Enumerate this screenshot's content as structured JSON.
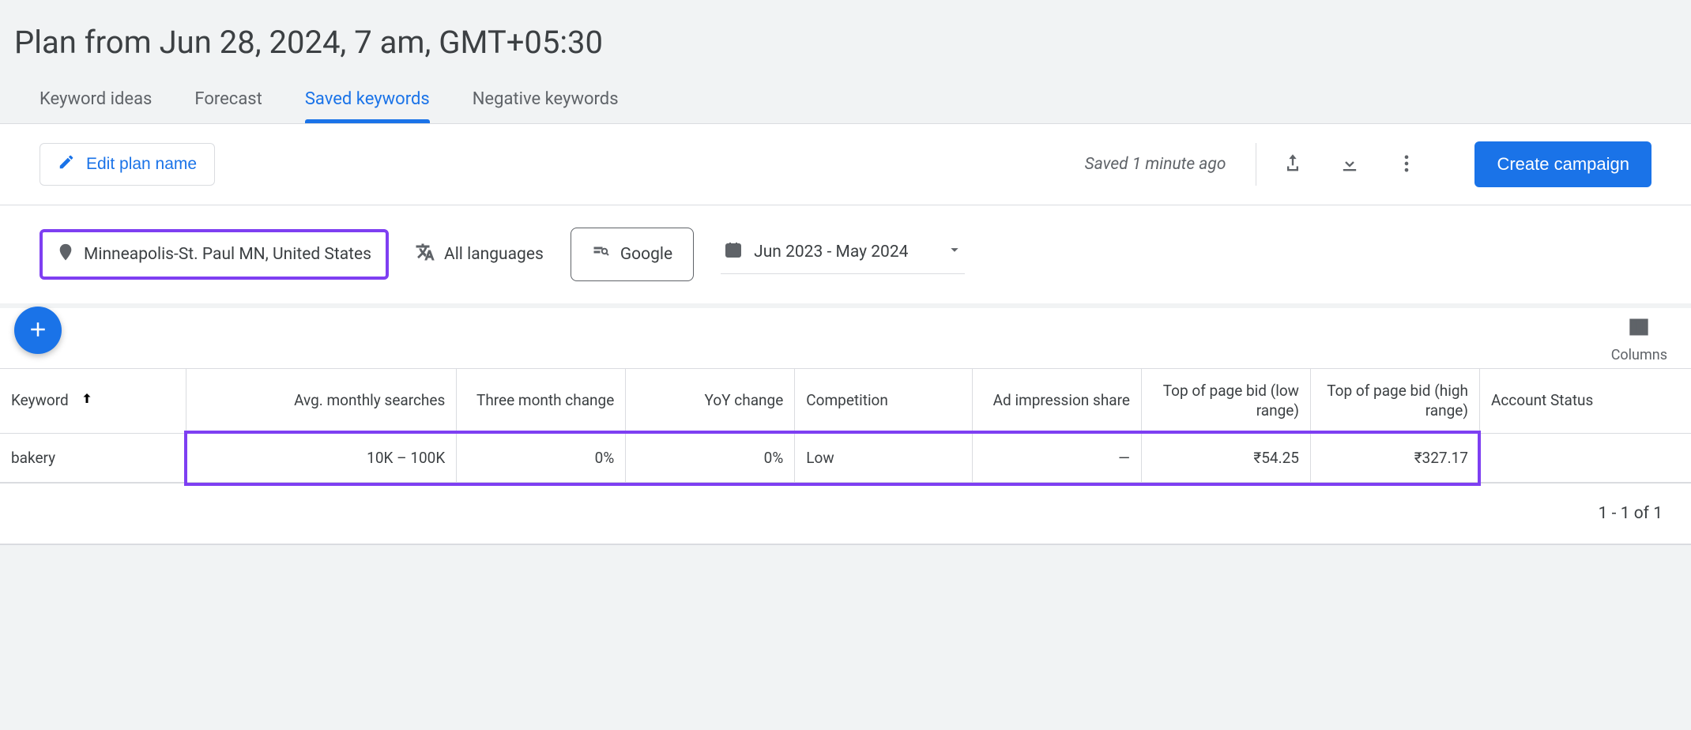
{
  "page_title": "Plan from Jun 28, 2024, 7 am, GMT+05:30",
  "tabs": {
    "keyword_ideas": "Keyword ideas",
    "forecast": "Forecast",
    "saved_keywords": "Saved keywords",
    "negative_keywords": "Negative keywords"
  },
  "toolbar": {
    "edit_plan_label": "Edit plan name",
    "saved_status": "Saved 1 minute ago",
    "create_campaign_label": "Create campaign"
  },
  "filters": {
    "location": "Minneapolis-St. Paul MN, United States",
    "language": "All languages",
    "search_network": "Google",
    "date_range": "Jun 2023 - May 2024"
  },
  "columns_label": "Columns",
  "table": {
    "headers": {
      "keyword": "Keyword",
      "avg_searches": "Avg. monthly searches",
      "three_month": "Three month change",
      "yoy": "YoY change",
      "competition": "Competition",
      "ad_impression": "Ad impression share",
      "bid_low": "Top of page bid (low range)",
      "bid_high": "Top of page bid (high range)",
      "account_status": "Account Status"
    },
    "rows": [
      {
        "keyword": "bakery",
        "avg_searches": "10K – 100K",
        "three_month": "0%",
        "yoy": "0%",
        "competition": "Low",
        "ad_impression": "—",
        "bid_low": "₹54.25",
        "bid_high": "₹327.17",
        "account_status": ""
      }
    ],
    "footer": "1 - 1 of 1"
  }
}
